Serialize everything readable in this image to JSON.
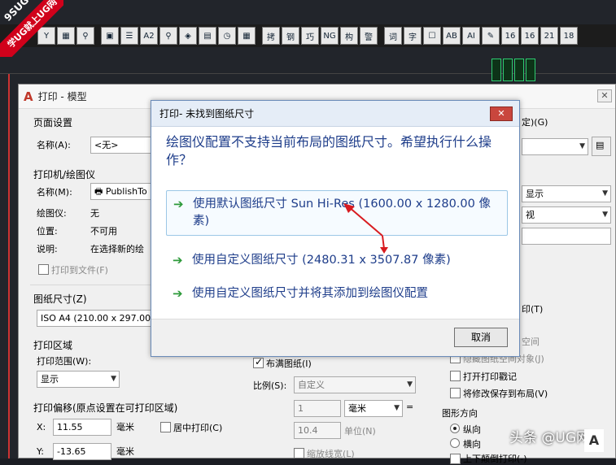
{
  "toolbar": {
    "icons": [
      "cut-icon",
      "table-icon",
      "search-icon",
      "block-icon",
      "list-icon",
      "a2-icon",
      "zoom-icon",
      "hatch-icon",
      "layer-icon",
      "clock-icon",
      "grid-icon",
      "text-icon",
      "steel-icon",
      "skill-icon",
      "ng-icon",
      "struct-icon",
      "warn-icon",
      "copy-icon",
      "char-icon",
      "erase-icon",
      "ab-icon",
      "ai-icon",
      "tag-icon",
      "l6-icon",
      "l16-icon",
      "l21-icon",
      "l18-icon"
    ],
    "glyphs": [
      "Y",
      "▦",
      "⚲",
      "▣",
      "☰",
      "A2",
      "⚲",
      "◈",
      "▤",
      "◷",
      "▦",
      "拷",
      "钢",
      "巧",
      "NG",
      "构",
      "警",
      "词",
      "字",
      "☐",
      "AB",
      "AI",
      "✎",
      "16",
      "16",
      "21",
      "18"
    ]
  },
  "badge": {
    "line1": "9SUG",
    "line2": "学UG就上UG网"
  },
  "print_dialog": {
    "title": "打印 - 模型",
    "page_setup": {
      "heading": "页面设置",
      "name_label": "名称(A):",
      "name_value": "<无>"
    },
    "printer": {
      "heading": "打印机/绘图仪",
      "name_label": "名称(M):",
      "name_value": "PublishTo",
      "plotter_label": "绘图仪:",
      "plotter_value": "无",
      "location_label": "位置:",
      "location_value": "不可用",
      "desc_label": "说明:",
      "desc_value": "在选择新的绘",
      "print_to_file": "打印到文件(F)"
    },
    "paper": {
      "heading": "图纸尺寸(Z)",
      "value": "ISO A4 (210.00 x 297.00"
    },
    "area": {
      "heading": "打印区域",
      "range_label": "打印范围(W):",
      "range_value": "显示"
    },
    "offset": {
      "heading": "打印偏移(原点设置在可打印区域)",
      "x_label": "X:",
      "x_value": "11.55",
      "x_unit": "毫米",
      "y_label": "Y:",
      "y_value": "-13.65",
      "y_unit": "毫米",
      "center": "居中打印(C)"
    },
    "scale": {
      "fit": "布满图纸(I)",
      "ratio_label": "比例(S):",
      "ratio_value": "自定义",
      "v1": "1",
      "unit1": "毫米",
      "v2": "10.4",
      "unit2": "单位(N)",
      "lineweight": "缩放线宽(L)"
    },
    "right": {
      "style_table": "定)(G)",
      "shade1": "显示",
      "shade2": "视",
      "print_opt_frag": "印(T)",
      "space_frag": "空间",
      "hide_paper": "隐藏图纸空间对象(J)",
      "stamp": "打开打印戳记",
      "save_layout": "将修改保存到布局(V)",
      "orient_heading": "图形方向",
      "portrait": "纵向",
      "landscape": "横向",
      "upside": "上下颠倒打印(-)"
    }
  },
  "alert": {
    "title": "打印- 未找到图纸尺寸",
    "close": "✕",
    "question": "绘图仪配置不支持当前布局的图纸尺寸。希望执行什么操作？",
    "option1": "使用默认图纸尺寸 Sun Hi-Res (1600.00 x 1280.00 像素)",
    "option2": "使用自定义图纸尺寸  (2480.31 x 3507.87 像素)",
    "option3": "使用自定义图纸尺寸并将其添加到绘图仪配置",
    "cancel": "取消",
    "annotation_color": "#d81b20"
  },
  "watermark": {
    "text": "头条 @UG网",
    "logo": "A"
  }
}
